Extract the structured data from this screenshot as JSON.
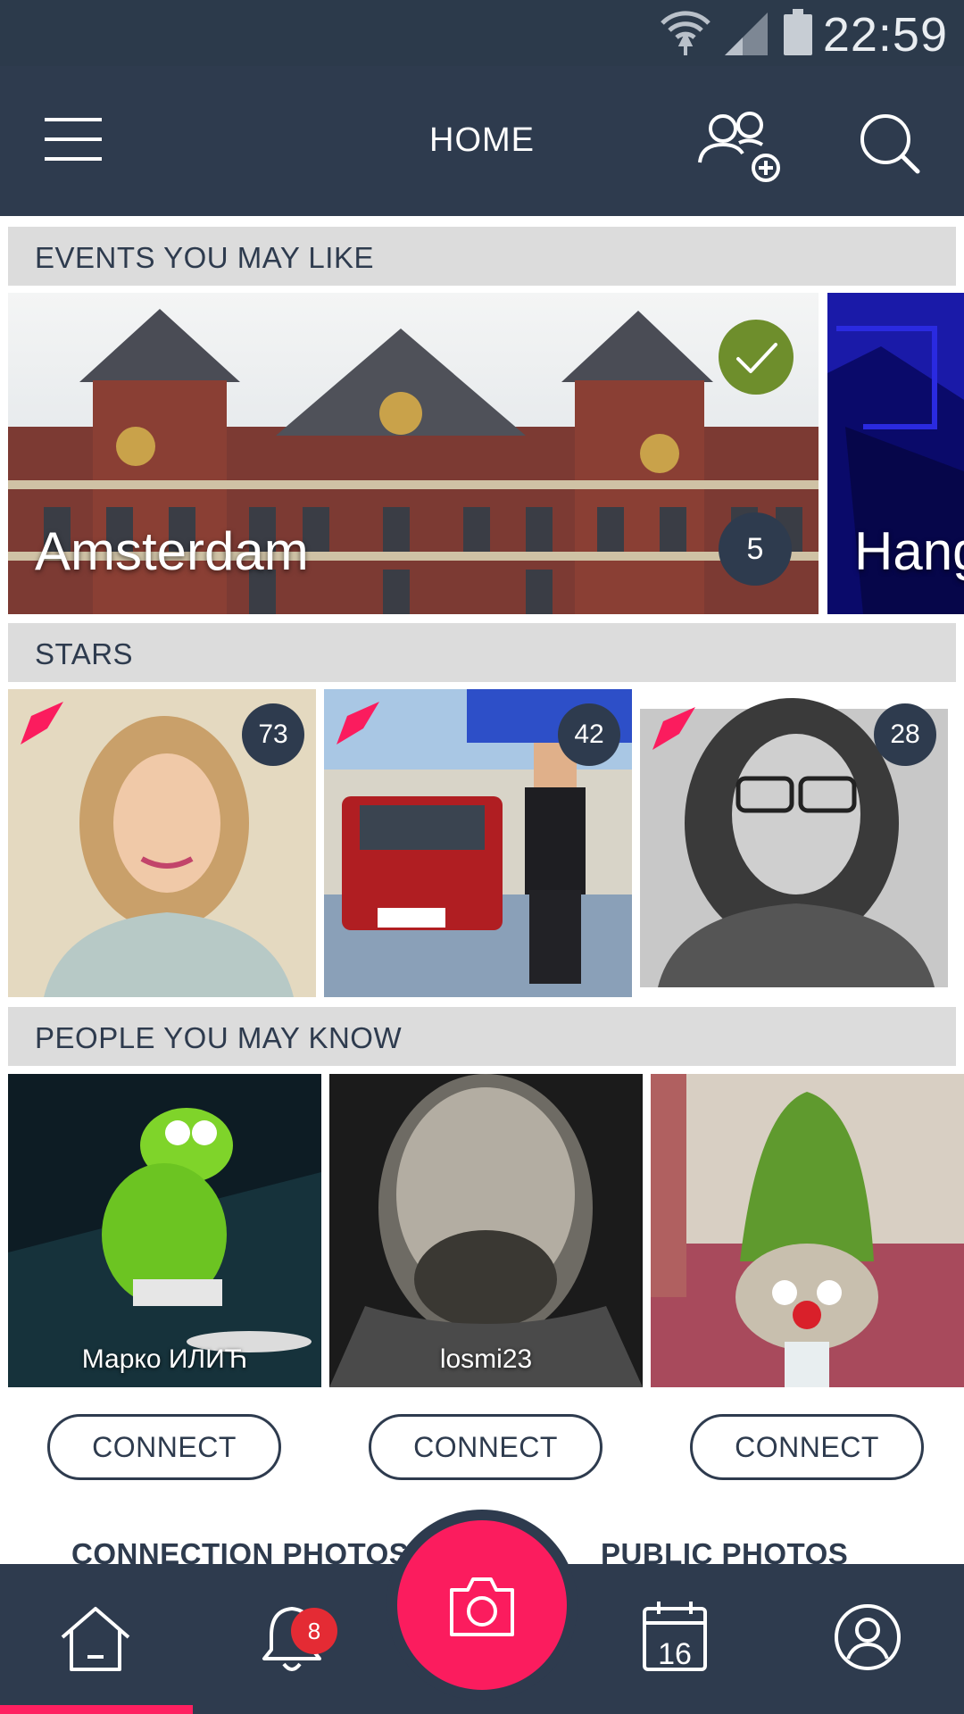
{
  "status_bar": {
    "time": "22:59"
  },
  "app_bar": {
    "title": "HOME"
  },
  "sections": {
    "events": "EVENTS YOU MAY LIKE",
    "stars": "STARS",
    "people": "PEOPLE YOU MAY KNOW"
  },
  "events": [
    {
      "name": "Amsterdam",
      "count": "5",
      "joined": true
    },
    {
      "name": "Hang"
    }
  ],
  "stars": [
    {
      "count": "73"
    },
    {
      "count": "42"
    },
    {
      "count": "28"
    }
  ],
  "people": [
    {
      "name": "Марко ИЛИЋ",
      "action": "CONNECT"
    },
    {
      "name": "losmi23",
      "action": "CONNECT"
    },
    {
      "name": "",
      "action": "CONNECT"
    }
  ],
  "photo_tabs": {
    "connection": "CONNECTION PHOTOS",
    "public": "PUBLIC PHOTOS"
  },
  "bottom_nav": {
    "notifications_count": "8",
    "calendar_day": "16"
  },
  "colors": {
    "primary": "#2e3b4e",
    "accent": "#fb1c5e",
    "joined_check": "#6e8e2c",
    "notification_badge": "#e42b34"
  }
}
